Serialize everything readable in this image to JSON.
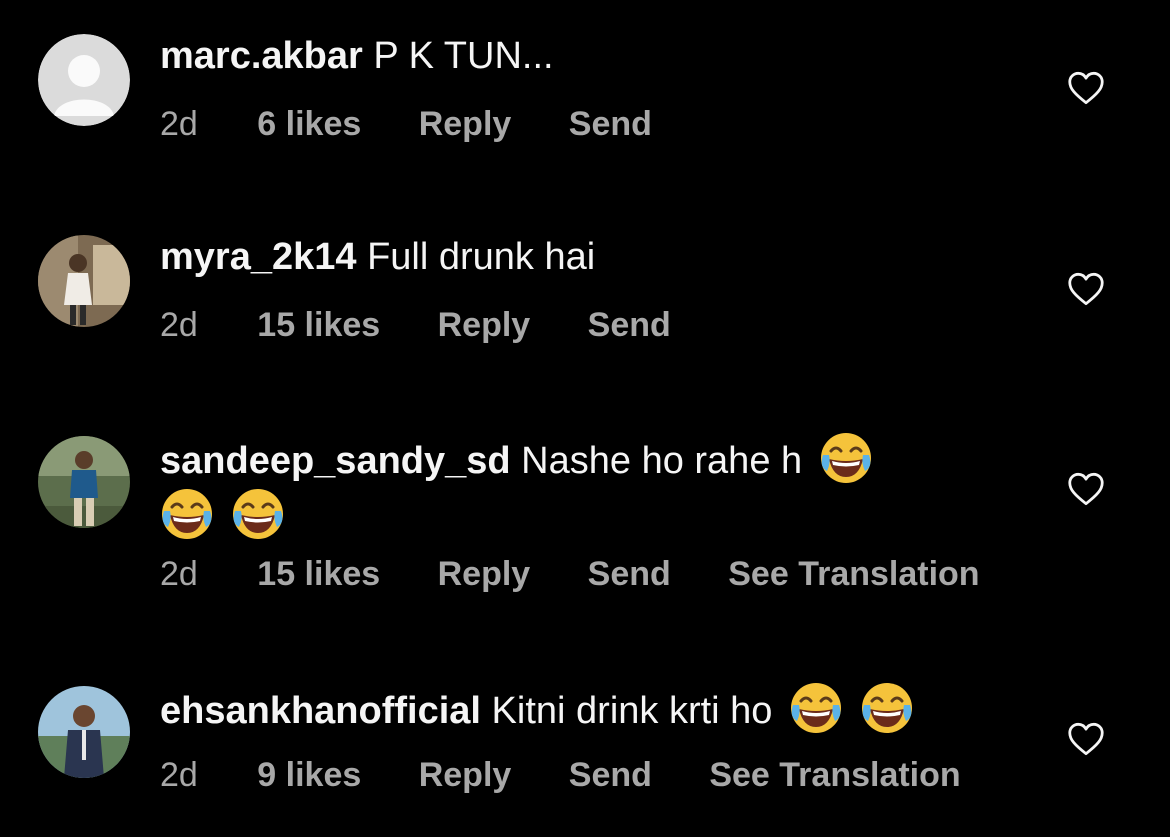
{
  "comments": [
    {
      "username": "marc.akbar",
      "text": "P K TUN...",
      "time": "2d",
      "likes": "6 likes",
      "reply_label": "Reply",
      "send_label": "Send",
      "see_translation_label": "",
      "avatar": "default-avatar"
    },
    {
      "username": "myra_2k14",
      "text": "Full drunk hai",
      "time": "2d",
      "likes": "15 likes",
      "reply_label": "Reply",
      "send_label": "Send",
      "see_translation_label": "",
      "avatar": "photo-avatar"
    },
    {
      "username": "sandeep_sandy_sd",
      "text": "Nashe ho rahe h",
      "emojis": [
        "😂",
        "😂",
        "😂"
      ],
      "time": "2d",
      "likes": "15 likes",
      "reply_label": "Reply",
      "send_label": "Send",
      "see_translation_label": "See Translation",
      "avatar": "photo-avatar"
    },
    {
      "username": "ehsankhanofficial",
      "text": "Kitni drink krti ho",
      "emojis": [
        "😂",
        "😂"
      ],
      "time": "2d",
      "likes": "9 likes",
      "reply_label": "Reply",
      "send_label": "Send",
      "see_translation_label": "See Translation",
      "avatar": "photo-avatar"
    }
  ],
  "icons": {
    "like": "heart-outline-icon",
    "emoji": "face-with-tears-of-joy-icon"
  },
  "colors": {
    "background": "#000000",
    "primary_text": "#f5f5f5",
    "secondary_text": "#a8a8a8"
  }
}
